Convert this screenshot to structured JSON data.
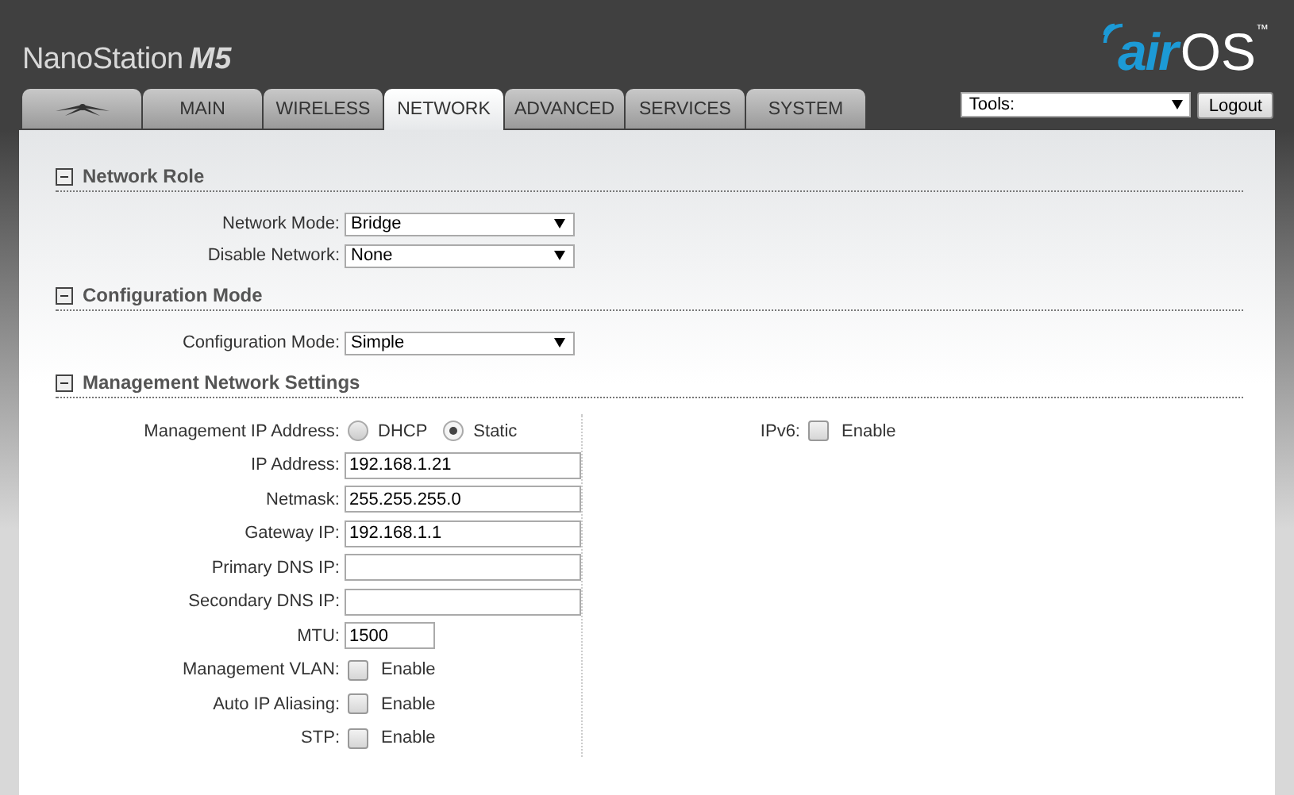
{
  "product": {
    "name": "NanoStation",
    "model": "M5"
  },
  "logo": {
    "prefix": "air",
    "suffix": "OS",
    "mark": "™"
  },
  "tabs": [
    {
      "kind": "icon",
      "selected": false
    },
    {
      "kind": "text",
      "label": "MAIN",
      "selected": false
    },
    {
      "kind": "text",
      "label": "WIRELESS",
      "selected": false
    },
    {
      "kind": "text",
      "label": "NETWORK",
      "selected": true
    },
    {
      "kind": "text",
      "label": "ADVANCED",
      "selected": false
    },
    {
      "kind": "text",
      "label": "SERVICES",
      "selected": false
    },
    {
      "kind": "text",
      "label": "SYSTEM",
      "selected": false
    }
  ],
  "tools": {
    "value": "Tools:"
  },
  "logout_button": "Logout",
  "sections": [
    {
      "title": "Network Role",
      "expanded": true,
      "left": [
        {
          "kind": "select",
          "label": "Network Mode:",
          "value": "Bridge"
        },
        {
          "kind": "select",
          "label": "Disable Network:",
          "value": "None"
        }
      ]
    },
    {
      "title": "Configuration Mode",
      "expanded": true,
      "left": [
        {
          "kind": "select",
          "label": "Configuration Mode:",
          "value": "Simple"
        }
      ]
    },
    {
      "title": "Management Network Settings",
      "expanded": true,
      "left": [
        {
          "kind": "radio",
          "label": "Management IP Address:",
          "options": [
            {
              "label": "DHCP",
              "selected": false
            },
            {
              "label": "Static",
              "selected": true
            }
          ]
        },
        {
          "kind": "text",
          "label": "IP Address:",
          "value": "192.168.1.21"
        },
        {
          "kind": "text",
          "label": "Netmask:",
          "value": "255.255.255.0"
        },
        {
          "kind": "text",
          "label": "Gateway IP:",
          "value": "192.168.1.1"
        },
        {
          "kind": "text",
          "label": "Primary DNS IP:"
        },
        {
          "kind": "text",
          "label": "Secondary DNS IP:"
        },
        {
          "kind": "short",
          "label": "MTU:",
          "value": "1500"
        },
        {
          "kind": "checkbox",
          "label": "Management VLAN:",
          "text": "Enable",
          "checked": false
        },
        {
          "kind": "checkbox",
          "label": "Auto IP Aliasing:",
          "text": "Enable",
          "checked": false
        },
        {
          "kind": "checkbox",
          "label": "STP:",
          "text": "Enable",
          "checked": false
        }
      ],
      "right": [
        {
          "kind": "checkbox",
          "label": "IPv6:",
          "text": "Enable",
          "checked": false
        }
      ]
    }
  ]
}
